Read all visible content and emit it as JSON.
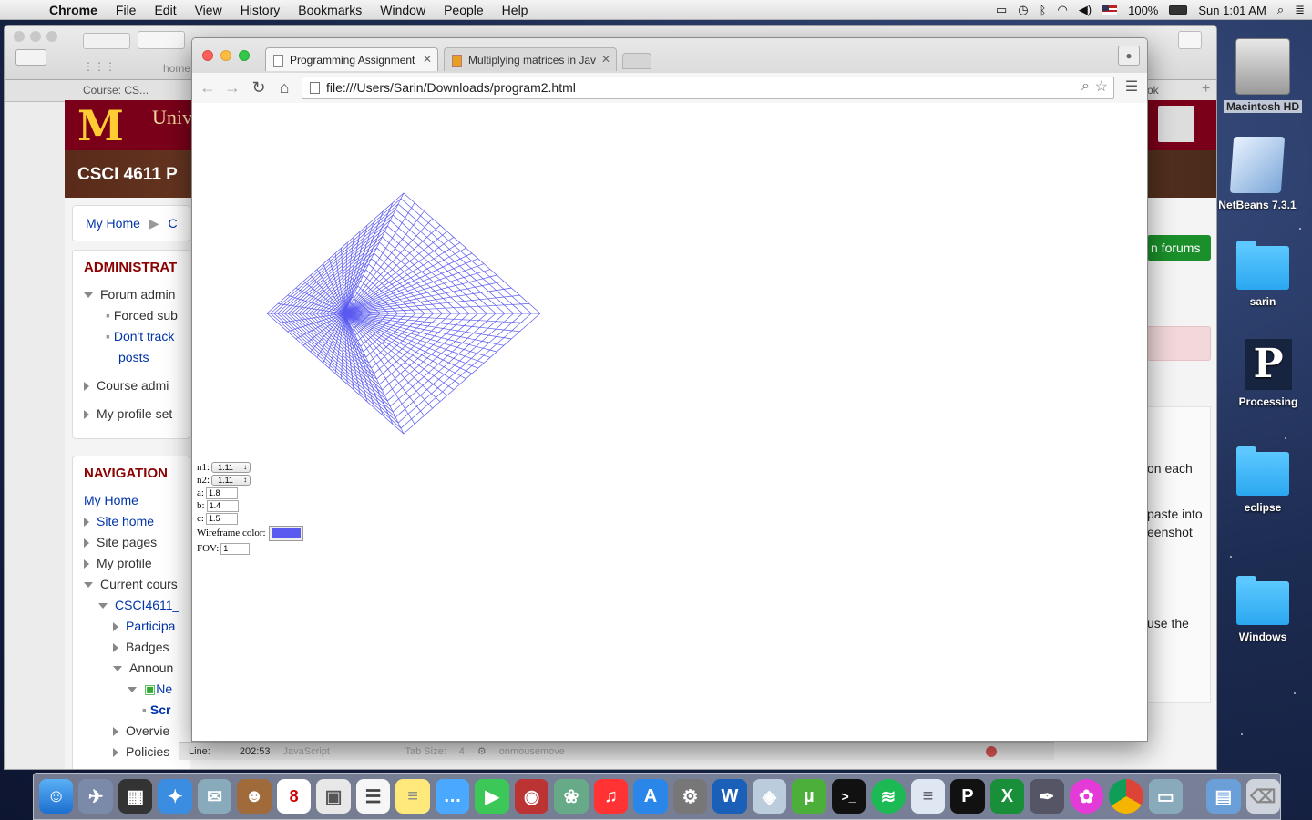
{
  "menubar": {
    "app": "Chrome",
    "items": [
      "File",
      "Edit",
      "View",
      "History",
      "Bookmarks",
      "Window",
      "People",
      "Help"
    ],
    "battery": "100%",
    "clock": "Sun 1:01 AM"
  },
  "background_browser": {
    "tab_label": "Course: CS...",
    "partial_tab": "home",
    "right_tab": "ok",
    "university": "Univ",
    "course_header": "CSCI 4611 P",
    "breadcrumb": [
      "My Home",
      "C"
    ],
    "forums_button": "n forums",
    "administration": {
      "heading": "ADMINISTRAT",
      "items": [
        {
          "label": "Forum admin",
          "state": "expanded",
          "link": false
        },
        {
          "label": "Forced sub",
          "state": "bullet",
          "link": false
        },
        {
          "label": "Don't track",
          "state": "bullet",
          "link": true
        },
        {
          "label": "posts",
          "state": "none",
          "link": true
        },
        {
          "label": "Course admi",
          "state": "collapsed",
          "link": false
        },
        {
          "label": "My profile set",
          "state": "collapsed",
          "link": false
        }
      ]
    },
    "navigation": {
      "heading": "NAVIGATION",
      "items": [
        {
          "label": "My Home",
          "state": "none",
          "link": true
        },
        {
          "label": "Site home",
          "state": "collapsed",
          "link": true
        },
        {
          "label": "Site pages",
          "state": "collapsed",
          "link": false
        },
        {
          "label": "My profile",
          "state": "collapsed",
          "link": false
        },
        {
          "label": "Current cours",
          "state": "expanded",
          "link": false
        },
        {
          "label": "CSCI4611_",
          "state": "expanded",
          "link": true
        },
        {
          "label": "Participa",
          "state": "collapsed",
          "link": true
        },
        {
          "label": "Badges",
          "state": "collapsed",
          "link": false
        },
        {
          "label": "Announ",
          "state": "expanded",
          "link": false
        },
        {
          "label": "Ne",
          "state": "expanded",
          "link": true
        },
        {
          "label": "Scr",
          "state": "bullet",
          "link": true
        },
        {
          "label": "Overvie",
          "state": "collapsed",
          "link": false
        },
        {
          "label": "Policies",
          "state": "collapsed",
          "link": false
        }
      ]
    },
    "right_snippets": [
      "on each",
      "paste into",
      "eenshot",
      "use the"
    ]
  },
  "chrome": {
    "tabs": [
      {
        "label": "Programming Assignment",
        "active": true
      },
      {
        "label": "Multiplying matrices in Jav",
        "active": false
      }
    ],
    "url": "file:///Users/Sarin/Downloads/program2.html",
    "page": {
      "wireframe_color": "#5a5af0",
      "controls": {
        "n1_label": "n1:",
        "n1_value": "1.11",
        "n2_label": "n2:",
        "n2_value": "1.11",
        "a_label": "a:",
        "a_value": "1.8",
        "b_label": "b:",
        "b_value": "1.4",
        "c_label": "c:",
        "c_value": "1.5",
        "color_label": "Wireframe color:",
        "fov_label": "FOV:",
        "fov_value": "1"
      }
    }
  },
  "editor_bar": {
    "line_label": "Line:",
    "line_value": "202:53",
    "language": "JavaScript",
    "tab_size": "Tab Size:",
    "tab_value": "4",
    "event": "onmousemove"
  },
  "desktop_icons": [
    "Macintosh HD",
    "NetBeans 7.3.1",
    "sarin",
    "Processing",
    "eclipse",
    "Windows"
  ]
}
